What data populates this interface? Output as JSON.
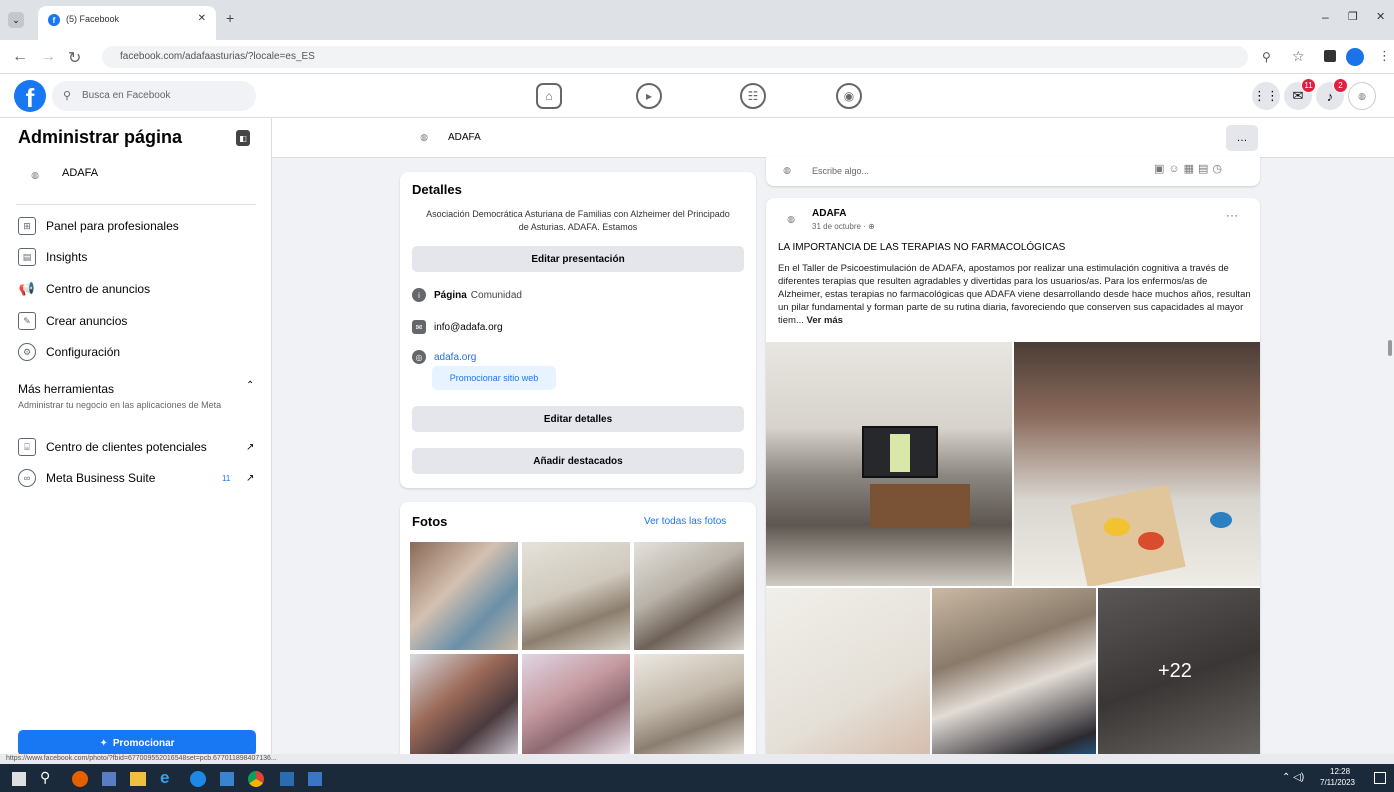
{
  "browser": {
    "tab_title": "(5) Facebook",
    "url": "facebook.com/adafaasturias/?locale=es_ES",
    "status_url": "https://www.facebook.com/photo/?fbid=677009552016548set=pcb.677011898407136..."
  },
  "fb_header": {
    "search_placeholder": "Busca en Facebook",
    "messenger_badge": "11",
    "notif_badge": "2"
  },
  "sidebar": {
    "title": "Administrar página",
    "page_name": "ADAFA",
    "items": [
      {
        "label": "Panel para profesionales",
        "icon": "dashboard-icon"
      },
      {
        "label": "Insights",
        "icon": "insights-icon"
      },
      {
        "label": "Centro de anuncios",
        "icon": "megaphone-icon"
      },
      {
        "label": "Crear anuncios",
        "icon": "edit-icon"
      },
      {
        "label": "Configuración",
        "icon": "gear-icon"
      }
    ],
    "tools_title": "Más herramientas",
    "tools_sub": "Administrar tu negocio en las aplicaciones de Meta",
    "tools_items": [
      {
        "label": "Centro de clientes potenciales"
      },
      {
        "label": "Meta Business Suite",
        "badge": "11"
      }
    ],
    "promote": "Promocionar"
  },
  "page_header": {
    "name": "ADAFA",
    "more": "…"
  },
  "details": {
    "title": "Detalles",
    "bio": "Asociación Democrática Asturiana de Familias con Alzheimer del Principado de Asturias. ADAFA. Estamos",
    "edit_bio": "Editar presentación",
    "category_label": "Página",
    "category": "Comunidad",
    "email": "info@adafa.org",
    "website": "adafa.org",
    "promote_web": "Promocionar sitio web",
    "edit_details": "Editar detalles",
    "add_featured": "Añadir destacados"
  },
  "photos": {
    "title": "Fotos",
    "see_all": "Ver todas las fotos"
  },
  "composer": {
    "placeholder": "Escribe algo..."
  },
  "post": {
    "author": "ADAFA",
    "date": "31 de octubre · ",
    "headline": "LA IMPORTANCIA DE LAS TERAPIAS NO FARMACOLÓGICAS",
    "body": "En el Taller de Psicoestimulación de ADAFA, apostamos por realizar una estimulación cognitiva a través de diferentes terapias que resulten agradables y divertidas para los usuarios/as. Para los enfermos/as de Alzheimer, estas terapias no farmacológicas que ADAFA viene desarrollando desde hace muchos años, resultan un pilar fundamental y forman parte de su rutina diaria, favoreciendo que conserven sus capacidades al mayor tiem...",
    "see_more": "Ver más",
    "more_photos": "+22"
  },
  "taskbar": {
    "time": "12:28",
    "date": "7/11/2023"
  }
}
